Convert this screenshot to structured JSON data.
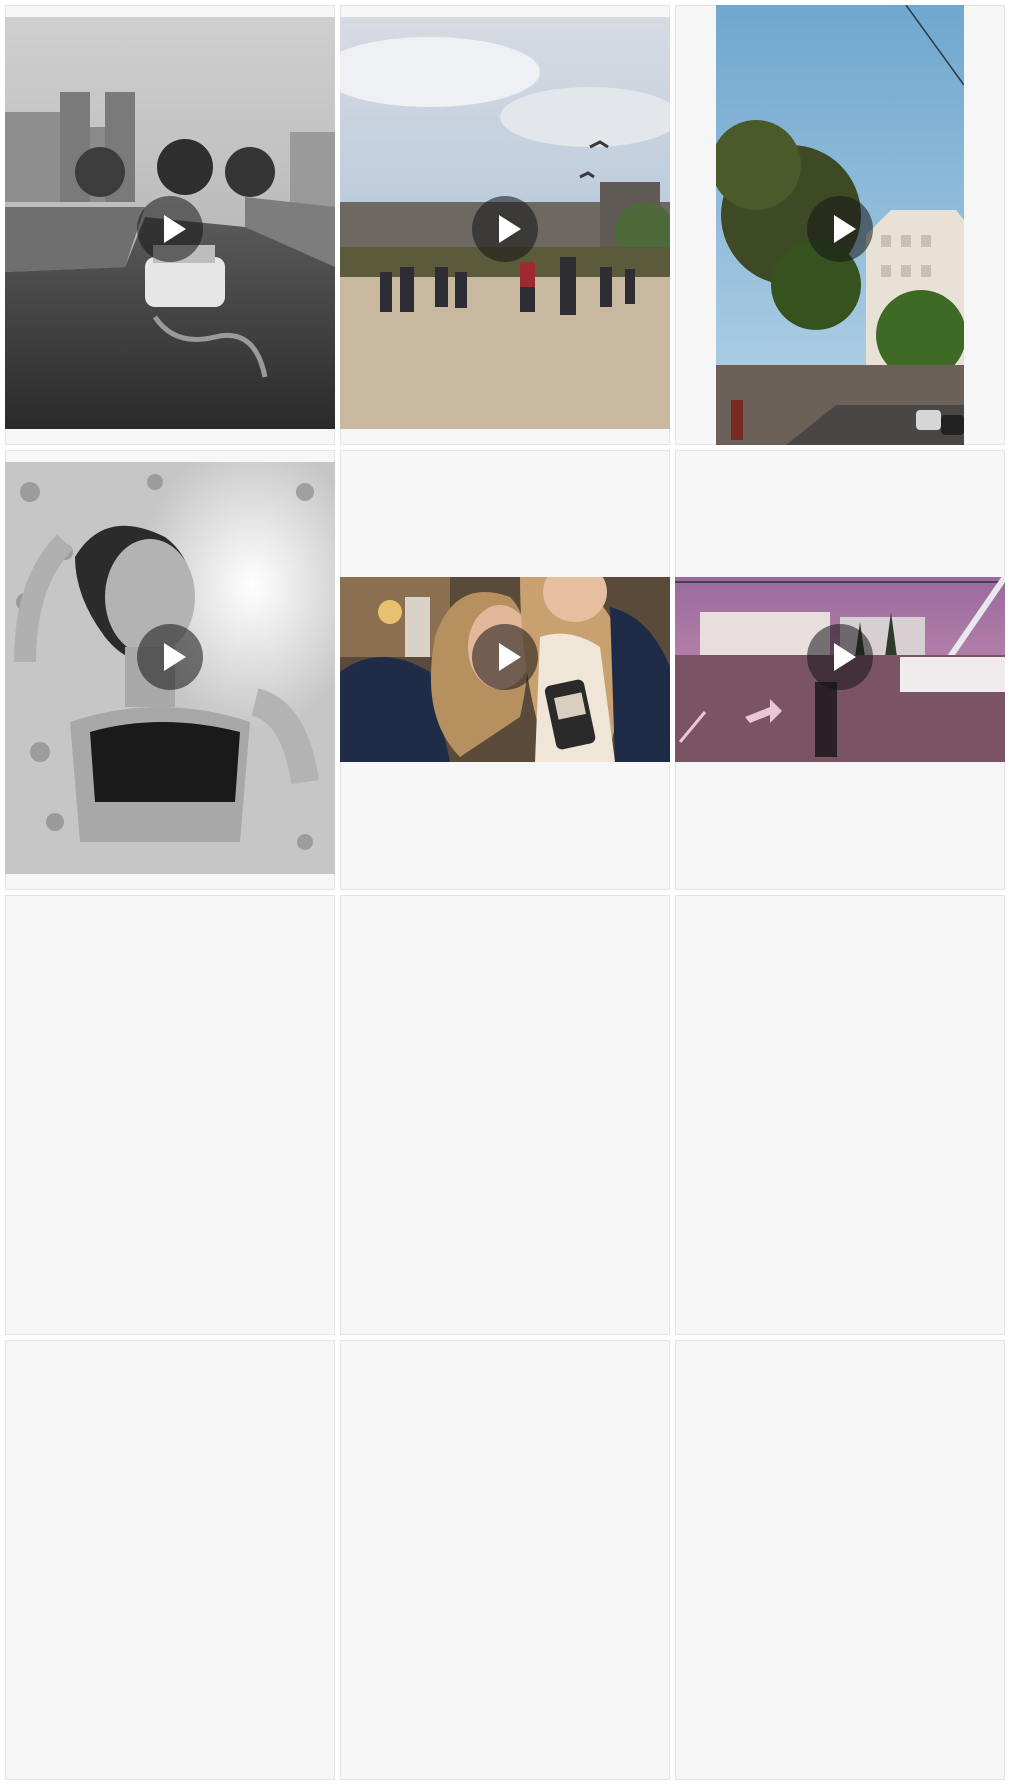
{
  "gallery": {
    "items": [
      {
        "kind": "video",
        "scene": "paris-river-boat",
        "icon": "play-icon"
      },
      {
        "kind": "video",
        "scene": "paris-garden-gulls",
        "icon": "play-icon"
      },
      {
        "kind": "video",
        "scene": "city-street-tree",
        "icon": "play-icon"
      },
      {
        "kind": "video",
        "scene": "woman-portrait-bw",
        "icon": "play-icon"
      },
      {
        "kind": "video",
        "scene": "two-friends-selfie",
        "icon": "play-icon"
      },
      {
        "kind": "video",
        "scene": "pink-sky-square",
        "icon": "play-icon"
      },
      {
        "kind": "empty"
      },
      {
        "kind": "empty"
      },
      {
        "kind": "empty"
      },
      {
        "kind": "empty"
      },
      {
        "kind": "empty"
      },
      {
        "kind": "empty"
      }
    ]
  }
}
